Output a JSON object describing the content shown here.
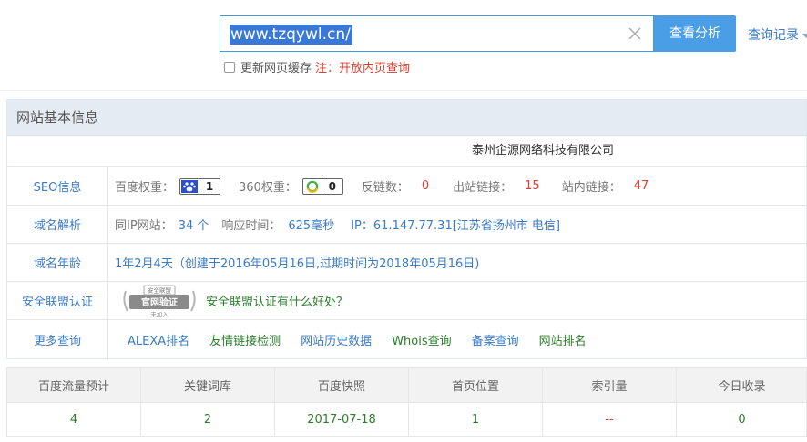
{
  "search": {
    "value": "www.tzqywl.cn/",
    "button_label": "查看分析",
    "history_label": "查询记录"
  },
  "cache": {
    "checkbox_label": "更新网页缓存",
    "note": "注：开放内页查询"
  },
  "panel": {
    "title": "网站基本信息",
    "company": "泰州企源网络科技有限公司",
    "seo": {
      "label": "SEO信息",
      "baidu_label": "百度权重：",
      "baidu_value": "1",
      "r360_label": "360权重：",
      "r360_value": "0",
      "backlinks_label": "反链数：",
      "backlinks_value": "0",
      "outbound_label": "出站链接：",
      "outbound_value": "15",
      "internal_label": "站内链接：",
      "internal_value": "47"
    },
    "domain": {
      "label": "域名解析",
      "same_ip_label": "同IP网站：",
      "same_ip_value": "34 个",
      "response_label": "响应时间：",
      "response_value": "625毫秒",
      "ip_text": "IP：61.147.77.31[江苏省扬州市 电信]"
    },
    "age": {
      "label": "域名年龄",
      "text": "1年2月4天（创建于2016年05月16日,过期时间为2018年05月16日)"
    },
    "security": {
      "label": "安全联盟认证",
      "seal_top": "安全联盟",
      "seal_main": "官网验证",
      "seal_sub": "未加入",
      "link_text": "安全联盟认证有什么好处？"
    },
    "more": {
      "label": "更多查询",
      "links": [
        "ALEXA排名",
        "友情链接检测",
        "网站历史数据",
        "Whois查询",
        "备案查询",
        "网站排名"
      ]
    }
  },
  "stats": {
    "headers": [
      "百度流量预计",
      "关键词库",
      "百度快照",
      "首页位置",
      "索引量",
      "今日收录"
    ],
    "values": [
      "4",
      "2",
      "2017-07-18",
      "1",
      "--",
      "0"
    ]
  },
  "colors": {
    "accent": "#4a9ee6",
    "link_blue": "#3a7bc8",
    "red": "#e03c2f",
    "green": "#2c7d2c"
  }
}
